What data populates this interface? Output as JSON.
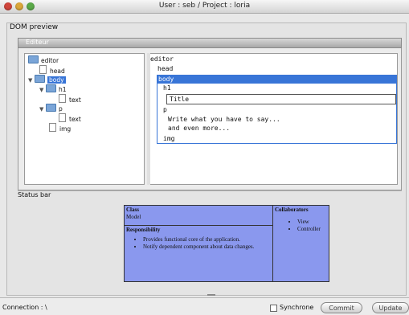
{
  "window": {
    "title": "User : seb / Project : loria"
  },
  "dom_preview_label": "DOM preview",
  "editor_label": "Editeur",
  "tree": [
    {
      "label": "editor",
      "indent": 0,
      "kind": "folder",
      "toggle": ""
    },
    {
      "label": "head",
      "indent": 1,
      "kind": "doc",
      "toggle": ""
    },
    {
      "label": "body",
      "indent": 0,
      "kind": "folder",
      "toggle": "▼",
      "selected": true
    },
    {
      "label": "h1",
      "indent": 1,
      "kind": "folder",
      "toggle": "▼"
    },
    {
      "label": "text",
      "indent": 2,
      "kind": "doc",
      "toggle": ""
    },
    {
      "label": "p",
      "indent": 1,
      "kind": "folder",
      "toggle": "▼"
    },
    {
      "label": "text",
      "indent": 2,
      "kind": "doc",
      "toggle": ""
    },
    {
      "label": "img",
      "indent": 1,
      "kind": "doc",
      "toggle": ""
    }
  ],
  "preview": {
    "editor": "editor",
    "head": "head",
    "body": "body",
    "h1": "h1",
    "title": "Title",
    "p": "p",
    "p_line1": "Write what you have to say...",
    "p_line2": "and even more...",
    "img": "img"
  },
  "status_bar": "Status bar",
  "crc": {
    "class_label": "Class",
    "class_name": "Model",
    "responsibility_label": "Responsibility",
    "responsibilities": [
      "Provides functional core of the application.",
      "Notify dependent component about data changes."
    ],
    "collaborators_label": "Collaborators",
    "collaborators": [
      "View",
      "Controller"
    ]
  },
  "bottom": {
    "connection": "Connection : \\",
    "synchrone": "Synchrone",
    "commit": "Commit",
    "update": "Update"
  }
}
